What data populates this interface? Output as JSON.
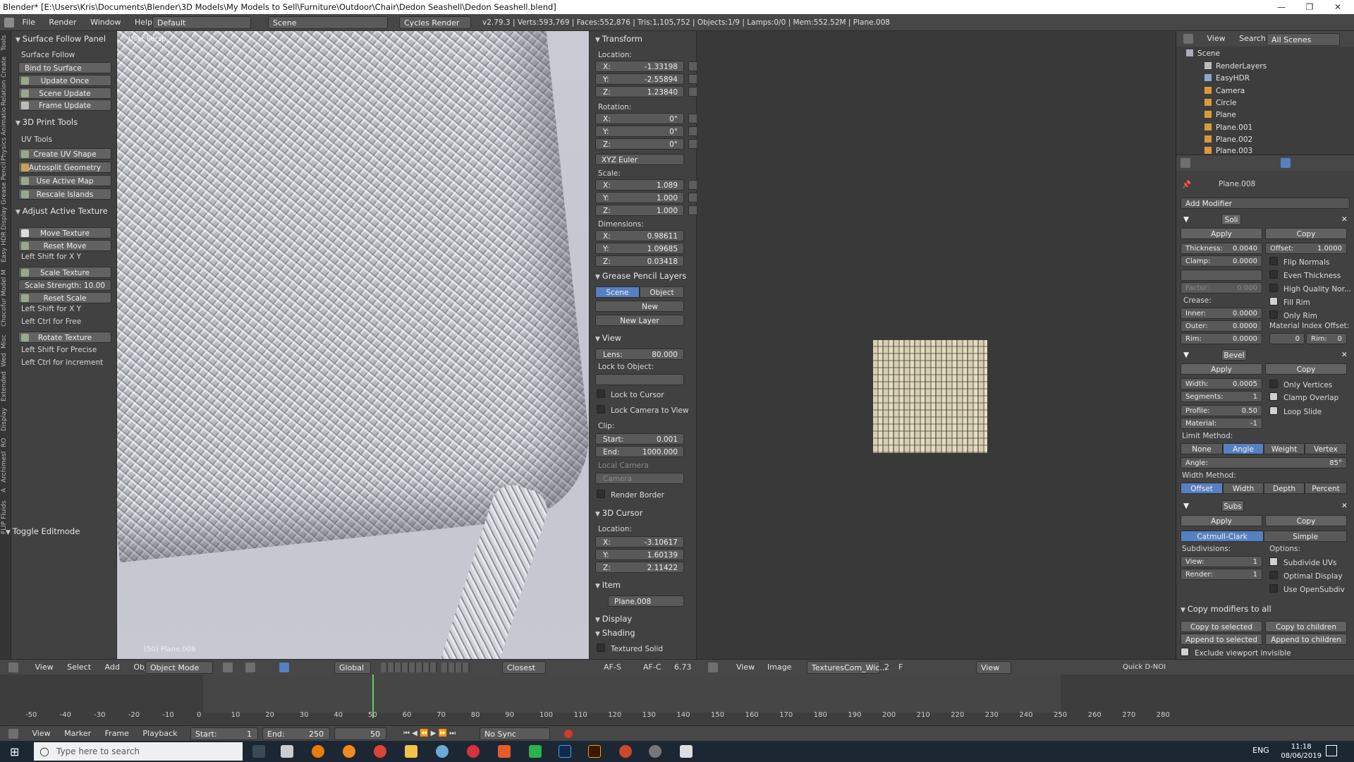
{
  "window": {
    "title": "Blender* [E:\\Users\\Kris\\Documents\\Blender\\3D Models\\My Models to Sell\\Furniture\\Outdoor\\Chair\\Dedon Seashell\\Dedon Seashell.blend]",
    "minimize": "—",
    "maximize": "❐",
    "close": "✕"
  },
  "infobar": {
    "menus": [
      "File",
      "Render",
      "Window",
      "Help"
    ],
    "layout": "Default",
    "scene": "Scene",
    "engine": "Cycles Render",
    "stats": "v2.79.3 | Verts:593,769 | Faces:552,876 | Tris:1,105,752 | Objects:1/9 | Lamps:0/0 | Mem:552.52M | Plane.008"
  },
  "tabs": [
    "Tools",
    "Create",
    "Relations",
    "Animation",
    "Physics",
    "Grease Pencil",
    "Display",
    "Easy HDRI",
    "Chocofur Model M",
    "Misc",
    "Wed",
    "Extended",
    "Display",
    "RO",
    "Archimesh",
    "A",
    "FLIP Fluids"
  ],
  "shelf": {
    "surface_follow_header": "Surface Follow Panel",
    "surface_follow_label": "Surface Follow",
    "bind": "Bind to Surface",
    "update_once": "Update Once",
    "scene_update": "Scene Update",
    "frame_update": "Frame Update",
    "print_header": "3D Print Tools",
    "uv_tools": "UV Tools",
    "create_uv": "Create UV Shape",
    "autosplit": "Autosplit Geometry",
    "use_active_map": "Use Active Map",
    "rescale_islands": "Rescale Islands",
    "adjust_header": "Adjust Active Texture",
    "move_texture": "Move Texture",
    "reset_move": "Reset Move",
    "left_shift_xy_1": "Left Shift for X Y",
    "scale_texture": "Scale Texture",
    "scale_strength_label": "Scale Strength:",
    "scale_strength_value": "10.00",
    "reset_scale": "Reset Scale",
    "left_shift_xy_2": "Left Shift for X Y",
    "left_ctrl_free": "Left Ctrl for Free",
    "rotate_texture": "Rotate Texture",
    "left_shift_precise": "Left Shift For Precise",
    "left_ctrl_increment": "Left Ctrl for increment",
    "toggle_editmode": "Toggle Editmode"
  },
  "viewport": {
    "label": "User Persp",
    "object": "(50) Plane.008"
  },
  "npanel": {
    "transform": "Transform",
    "location": "Location:",
    "loc": [
      {
        "k": "X:",
        "v": "-1.33198"
      },
      {
        "k": "Y:",
        "v": "-2.55894"
      },
      {
        "k": "Z:",
        "v": "1.23840"
      }
    ],
    "rotation": "Rotation:",
    "rot": [
      {
        "k": "X:",
        "v": "0°"
      },
      {
        "k": "Y:",
        "v": "0°"
      },
      {
        "k": "Z:",
        "v": "0°"
      }
    ],
    "rotation_mode": "XYZ Euler",
    "scale": "Scale:",
    "scl": [
      {
        "k": "X:",
        "v": "1.089"
      },
      {
        "k": "Y:",
        "v": "1.000"
      },
      {
        "k": "Z:",
        "v": "1.000"
      }
    ],
    "dimensions": "Dimensions:",
    "dim": [
      {
        "k": "X:",
        "v": "0.98611"
      },
      {
        "k": "Y:",
        "v": "1.09685"
      },
      {
        "k": "Z:",
        "v": "0.03418"
      }
    ],
    "gp_header": "Grease Pencil Layers",
    "gp_scene": "Scene",
    "gp_object": "Object",
    "gp_new": "New",
    "gp_new_layer": "New Layer",
    "view_header": "View",
    "lens_label": "Lens:",
    "lens_value": "80.000",
    "lock_to_object": "Lock to Object:",
    "lock_to_cursor": "Lock to Cursor",
    "lock_camera": "Lock Camera to View",
    "clip": "Clip:",
    "clip_start_label": "Start:",
    "clip_start": "0.001",
    "clip_end_label": "End:",
    "clip_end": "1000.000",
    "local_camera": "Local Camera",
    "camera": "Camera",
    "render_border": "Render Border",
    "cursor_header": "3D Cursor",
    "cursor_location": "Location:",
    "cur": [
      {
        "k": "X:",
        "v": "-3.10617"
      },
      {
        "k": "Y:",
        "v": "1.60139"
      },
      {
        "k": "Z:",
        "v": "2.11422"
      }
    ],
    "item_header": "Item",
    "item_name": "Plane.008",
    "display_header": "Display",
    "shading_header": "Shading",
    "textured_solid": "Textured Solid"
  },
  "outliner": {
    "view": "View",
    "search": "Search",
    "scenes": "All Scenes",
    "items": [
      "Scene",
      "RenderLayers",
      "EasyHDR",
      "Camera",
      "Circle",
      "Plane",
      "Plane.001",
      "Plane.002",
      "Plane.003"
    ]
  },
  "props": {
    "object": "Plane.008",
    "add_modifier": "Add Modifier",
    "solidify": {
      "name": "Soli",
      "apply": "Apply",
      "copy": "Copy",
      "thickness_label": "Thickness:",
      "thickness": "0.0040",
      "offset_label": "Offset:",
      "offset": "1.0000",
      "clamp_label": "Clamp:",
      "clamp": "0.0000",
      "flip_normals": "Flip Normals",
      "even_thickness": "Even Thickness",
      "high_quality": "High Quality Nor...",
      "factor_label": "Factor:",
      "factor": "0.000",
      "fill_rim": "Fill Rim",
      "only_rim": "Only Rim",
      "crease": "Crease:",
      "inner_label": "Inner:",
      "inner": "0.0000",
      "outer_label": "Outer:",
      "outer": "0.0000",
      "rim_label": "Rim:",
      "rim": "0.0000",
      "mat_offset": "Material Index Offset:",
      "mat_offset_v": "0",
      "mat_rim_label": "Rim:",
      "mat_rim": "0"
    },
    "bevel": {
      "name": "Bevel",
      "apply": "Apply",
      "copy": "Copy",
      "width_label": "Width:",
      "width": "0.0005",
      "only_vertices": "Only Vertices",
      "segments_label": "Segments:",
      "segments": "1",
      "clamp_overlap": "Clamp Overlap",
      "profile_label": "Profile:",
      "profile": "0.50",
      "loop_slide": "Loop Slide",
      "material_label": "Material:",
      "material": "-1",
      "limit_method": "Limit Method:",
      "limits": [
        "None",
        "Angle",
        "Weight",
        "Vertex Gr..."
      ],
      "angle_label": "Angle:",
      "angle": "85°",
      "width_method": "Width Method:",
      "wmethods": [
        "Offset",
        "Width",
        "Depth",
        "Percent"
      ]
    },
    "subsurf": {
      "name": "Subs",
      "apply": "Apply",
      "copy": "Copy",
      "catmull": "Catmull-Clark",
      "simple": "Simple",
      "subdivisions": "Subdivisions:",
      "options": "Options:",
      "view_label": "View:",
      "view": "1",
      "render_label": "Render:",
      "render": "1",
      "subdivide_uvs": "Subdivide UVs",
      "optimal_display": "Optimal Display",
      "use_opensubdiv": "Use OpenSubdiv"
    },
    "copy_all": "Copy modifiers to all",
    "copy_selected": "Copy to selected",
    "copy_children": "Copy to children",
    "append_selected": "Append to selected",
    "append_children": "Append to children",
    "exclude_invisible": "Exclude viewport invisible"
  },
  "vphdr": {
    "menus": [
      "View",
      "Select",
      "Add",
      "Object"
    ],
    "mode": "Object Mode",
    "orientation": "Global",
    "snap": "Closest",
    "af_s": "AF-S",
    "af_c": "AF-C",
    "zoom": "6.73",
    "img_menus": [
      "View",
      "Image"
    ],
    "image": "TexturesCom_Wic...",
    "users": "2",
    "fake": "F",
    "img_view": "View",
    "quick": "Quick D-NOI"
  },
  "timeline": {
    "ticks": [
      "-50",
      "-40",
      "-30",
      "-20",
      "-10",
      "0",
      "10",
      "20",
      "30",
      "40",
      "50",
      "60",
      "70",
      "80",
      "90",
      "100",
      "110",
      "120",
      "130",
      "140",
      "150",
      "160",
      "170",
      "180",
      "190",
      "200",
      "210",
      "220",
      "230",
      "240",
      "250",
      "260",
      "270",
      "280"
    ],
    "menus": [
      "View",
      "Marker",
      "Frame",
      "Playback"
    ],
    "start_label": "Start:",
    "start": "1",
    "end_label": "End:",
    "end": "250",
    "current": "50",
    "sync": "No Sync"
  },
  "taskbar": {
    "search": "Type here to search",
    "lang": "ENG",
    "time": "11:18",
    "date": "08/06/2019"
  }
}
